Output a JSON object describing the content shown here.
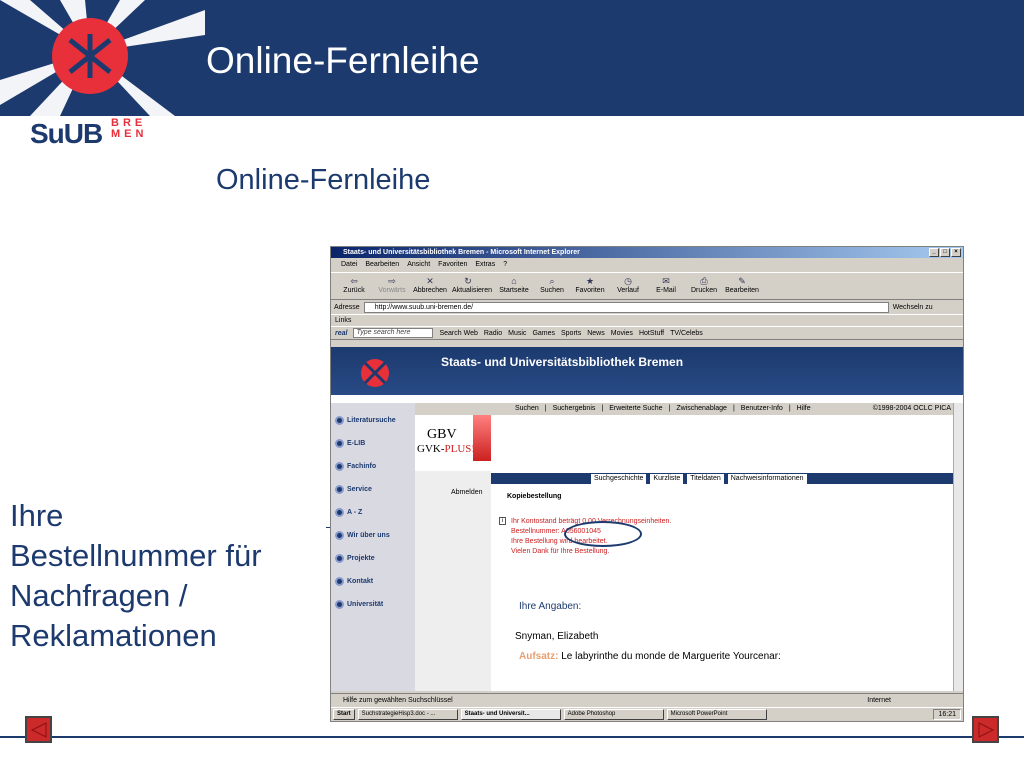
{
  "slide": {
    "title": "Online-Fernleihe",
    "subtitle": "Online-Fernleihe",
    "side_text_lines": [
      "Ihre",
      "Bestellnummer für",
      "Nachfragen /",
      "Reklamationen"
    ],
    "logo_text": "SuUB",
    "logo_sub_top": "BRE",
    "logo_sub_bottom": "MEN"
  },
  "colors": {
    "brand_blue": "#1c3a6e",
    "brand_red": "#e8303b",
    "white": "#ffffff"
  },
  "browser": {
    "window_title": "Staats- und Universitätsbibliothek Bremen - Microsoft Internet Explorer",
    "menu": [
      "Datei",
      "Bearbeiten",
      "Ansicht",
      "Favoriten",
      "Extras",
      "?"
    ],
    "toolbar": [
      {
        "label": "Zurück",
        "icon": "back-arrow-icon"
      },
      {
        "label": "Vorwärts",
        "icon": "forward-arrow-icon"
      },
      {
        "label": "Abbrechen",
        "icon": "stop-icon"
      },
      {
        "label": "Aktualisieren",
        "icon": "refresh-icon"
      },
      {
        "label": "Startseite",
        "icon": "home-icon"
      },
      {
        "label": "Suchen",
        "icon": "search-icon"
      },
      {
        "label": "Favoriten",
        "icon": "favorites-icon"
      },
      {
        "label": "Verlauf",
        "icon": "history-icon"
      },
      {
        "label": "E-Mail",
        "icon": "mail-icon"
      },
      {
        "label": "Drucken",
        "icon": "print-icon"
      },
      {
        "label": "Bearbeiten",
        "icon": "edit-icon"
      }
    ],
    "address_label": "Adresse",
    "address_value": "http://www.suub.uni-bremen.de/",
    "go_label": "Wechseln zu",
    "links_label": "Links",
    "radio_bar": {
      "brand": "real",
      "search_placeholder": "Type search here",
      "items": [
        "Search Web",
        "Radio",
        "Music",
        "Games",
        "Sports",
        "News",
        "Movies",
        "HotStuff",
        "TV/Celebs"
      ]
    },
    "page": {
      "banner_title": "Staats- und Universitätsbibliothek Bremen",
      "sidenav": [
        "Literatursuche",
        "E-LIB",
        "Fachinfo",
        "Service",
        "A - Z",
        "Wir über uns",
        "Projekte",
        "Kontakt",
        "Universität"
      ],
      "topnav": [
        "Suchen",
        "Suchergebnis",
        "Erweiterte Suche",
        "Zwischenablage",
        "Benutzer-Info",
        "Hilfe"
      ],
      "copyright": "©1998-2004 OCLC PICA",
      "gbv": "GBV",
      "gvk": "GVK-",
      "gvk_plus": "PLUS!",
      "tabs": [
        "Suchgeschichte",
        "Kurzliste",
        "Titeldaten",
        "Nachweisinformationen"
      ],
      "abmelden": "Abmelden",
      "kopie": "Kopiebestellung",
      "message_lines": [
        "Ihr Kontostand beträgt 0,00 Verrechnungseinheiten.",
        "Bestellnummer: A056001045",
        "Ihre Bestellung wird bearbeitet.",
        "Vielen Dank für Ihre Bestellung."
      ],
      "angaben": "Ihre Angaben:",
      "author": "Snyman, Elizabeth",
      "aufsatz_label": "Aufsatz:",
      "aufsatz_value": "Le labyrinthe du monde de Marguerite Yourcenar:"
    },
    "status_text": "Hilfe zum gewählten Suchschlüssel",
    "status_zone": "Internet",
    "taskbar": {
      "start": "Start",
      "tasks": [
        "SuchstrategieHisp3.doc - ...",
        "Staats- und Universit...",
        "Adobe Photoshop",
        "Microsoft PowerPoint"
      ],
      "clock": "16:21"
    }
  }
}
